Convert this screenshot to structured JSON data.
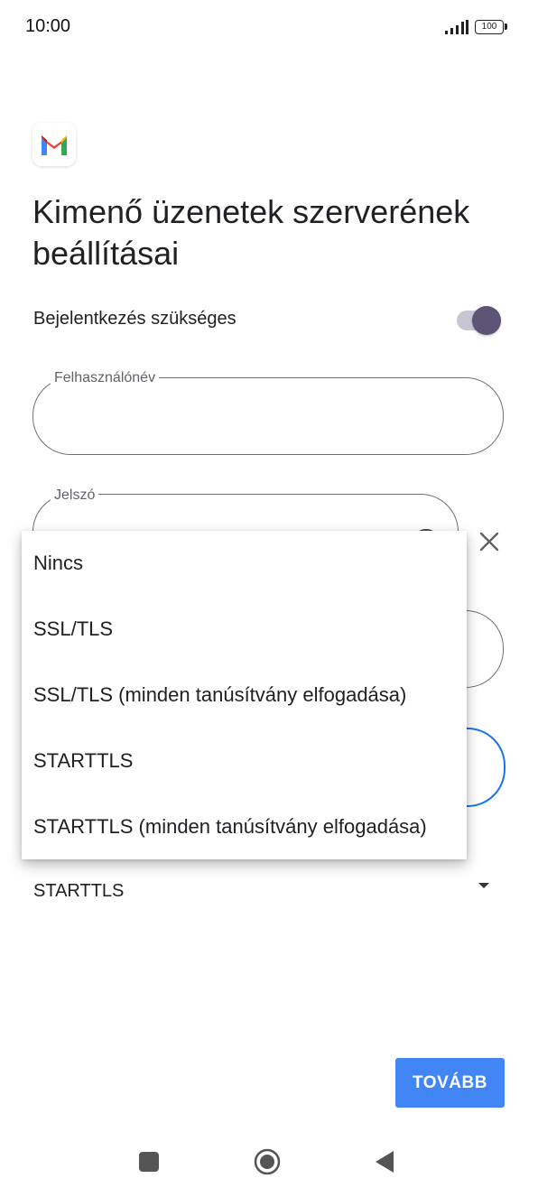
{
  "status_bar": {
    "time": "10:00",
    "battery": "100"
  },
  "page": {
    "title": "Kimenő üzenetek szerverének beállításai"
  },
  "login_toggle": {
    "label": "Bejelentkezés szükséges",
    "state": "on"
  },
  "fields": {
    "username": {
      "label": "Felhasználónév",
      "value": ""
    },
    "password": {
      "label": "Jelszó",
      "value": ""
    }
  },
  "security": {
    "selected": "STARTTLS",
    "options": [
      "Nincs",
      "SSL/TLS",
      "SSL/TLS (minden tanúsítvány elfogadása)",
      "STARTTLS",
      "STARTTLS (minden tanúsítvány elfogadása)"
    ]
  },
  "next_button": {
    "label": "TOVÁBB"
  },
  "colors": {
    "accent": "#4285f4",
    "toggle_knob": "#5b5474"
  }
}
